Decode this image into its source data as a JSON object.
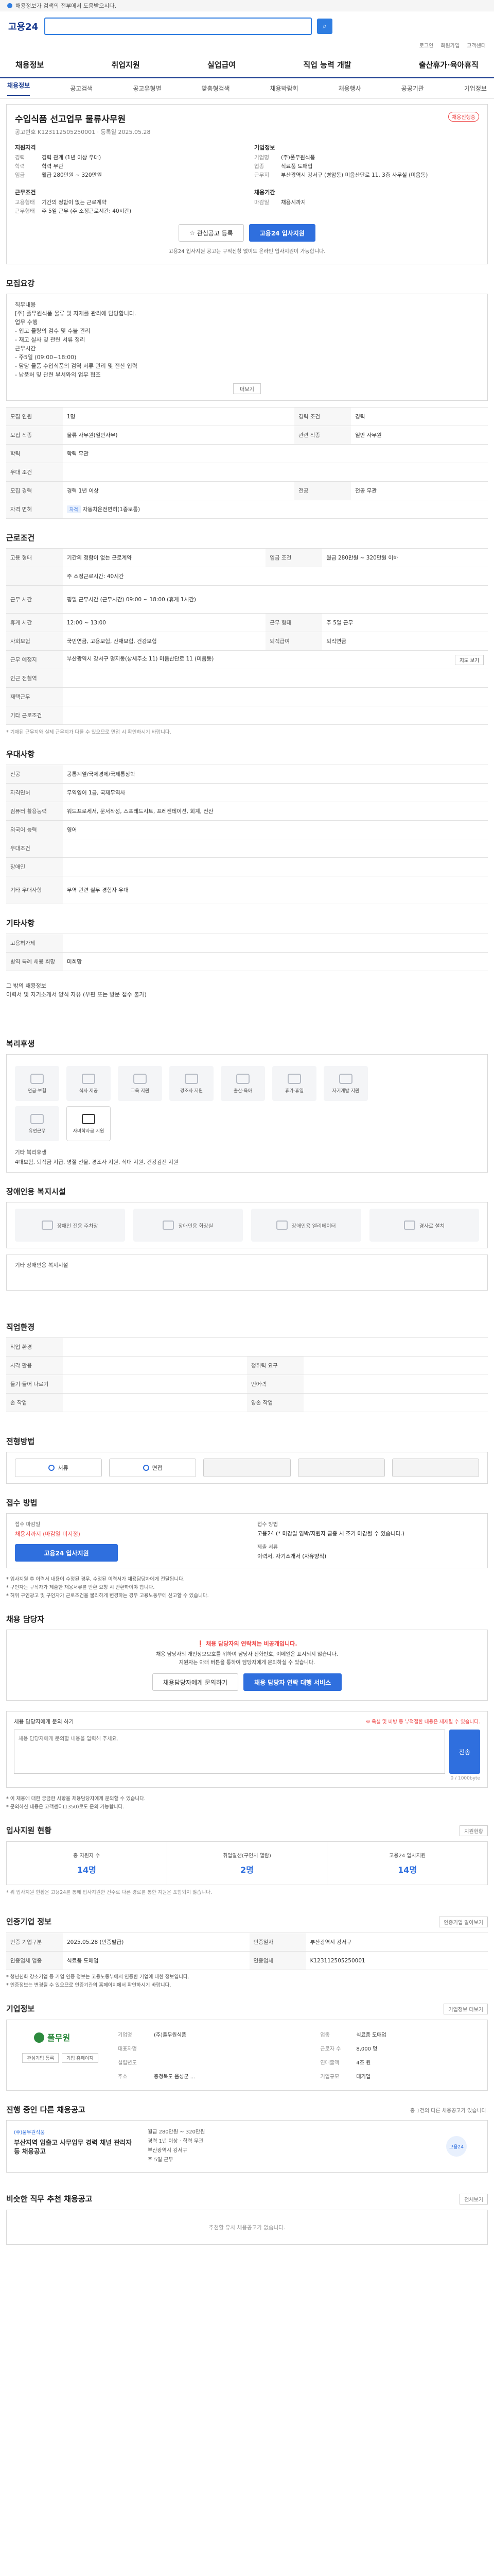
{
  "browser_bar": "채용정보가 검색의 전부에서 도움받으시다.",
  "logo": "고용24",
  "search_placeholder": "",
  "util": [
    "로그인",
    "회원가입",
    "고객센터"
  ],
  "gnb": [
    "채용정보",
    "취업지원",
    "실업급여",
    "직업 능력 개발",
    "출산휴가·육아휴직"
  ],
  "lnb": [
    "채용정보",
    "공고검색",
    "공고유형별",
    "맞춤형검색",
    "채용박람회",
    "채용행사",
    "공공기관",
    "기업정보"
  ],
  "job": {
    "title": "수입식품 선고업무 물류사무원",
    "tag": "채용진행중",
    "meta": "공고번호 K123112505250001  ·  등록일 2025.05.28",
    "cond_title": "지원자격",
    "company_title": "기업정보",
    "cond": [
      {
        "k": "경력",
        "v": "경력 관계 (1년 이상 우대)"
      },
      {
        "k": "학력",
        "v": "학력 무관"
      },
      {
        "k": "임금",
        "v": "월급 280만원 ~ 320만원"
      }
    ],
    "work_title": "근무조건",
    "work": [
      {
        "k": "고용형태",
        "v": "기간의 정함이 없는 근로계약"
      },
      {
        "k": "근무형태",
        "v": "주 5일 근무 (주 소정근로시간: 40시간)"
      }
    ],
    "company": [
      {
        "k": "기업명",
        "v": "(주)풀무원식품"
      },
      {
        "k": "업종",
        "v": "식료품 도매업"
      },
      {
        "k": "근무지",
        "v": "부산광역시 강서구 (병암동) 미음산단로 11, 3층 사무실 (미음동)"
      }
    ],
    "recruit_title": "채용기간",
    "recruit": [
      {
        "k": "마감일",
        "v": "채용시까지"
      }
    ],
    "btn_like": "관심공고 등록",
    "btn_apply": "고용24 입사지원",
    "notice": "고용24 입사지원 공고는 구직신청 없이도 온라인 입사지원이 가능합니다."
  },
  "sec_duty": "모집요강",
  "duty_text": "직무내용\n[주] 풀무원식품 물류 및 자재를 관리에 담당합니다.\n업무 수행\n- 입고 물량의 검수 및 수불 관리\n- 재고 실사 및 관련 서류 정리\n근무시간\n- 주5일 (09:00~18:00)\n- 담당 물품 수입식품의 검역 서류 관리 및 전산 입력\n- 납품처 및 관련 부서와의 업무 협조",
  "duty_more": "더보기",
  "duty_table": [
    {
      "h": "모집 인원",
      "v": "1명",
      "h2": "경력 조건",
      "v2": "경력"
    },
    {
      "h": "모집 직종",
      "v": "물류 사무원(일반사무)",
      "h2": "관련 직종",
      "v2": "일반 사무원"
    },
    {
      "h": "학력",
      "v": "학력 무관",
      "h2": "",
      "v2": ""
    },
    {
      "h": "우대 조건",
      "v": "",
      "h2": "",
      "v2": ""
    },
    {
      "h": "모집 경력",
      "v": "경력 1년 이상",
      "h2": "전공",
      "v2": "전공 무관"
    },
    {
      "h": "자격 면허",
      "v": "자동차운전면허(1종보통)",
      "h2": "",
      "v2": ""
    }
  ],
  "sec_work": "근로조건",
  "work_table": [
    {
      "h": "고용 형태",
      "v": "기간의 정함이 없는 근로계약",
      "h2": "임금 조건",
      "v2": "월급 280만원 ~ 320만원 이하"
    },
    {
      "h": "",
      "v": "주 소정근로시간: 40시간",
      "h2": "",
      "v2": ""
    },
    {
      "h": "근무 시간",
      "v": "평일 근무시간 (근무시간) 09:00 ~ 18:00 (휴게 1시간)",
      "h2": "",
      "v2": ""
    },
    {
      "h": "휴게 시간",
      "v": "12:00 ~ 13:00",
      "h2": "근무 형태",
      "v2": "주 5일 근무"
    },
    {
      "h": "사회보험",
      "v": "국민연금, 고용보험, 산재보험, 건강보험",
      "h2": "퇴직급여",
      "v2": "퇴직연금"
    },
    {
      "h": "근무 예정지",
      "v": "부산광역시 강서구 명지동(상세주소 11) 미음산단로 11 (미음동)",
      "h2": "",
      "v2": ""
    },
    {
      "h": "인근 전철역",
      "v": "",
      "h2": "",
      "v2": ""
    },
    {
      "h": "재택근무",
      "v": "",
      "h2": "",
      "v2": ""
    },
    {
      "h": "기타 근로조건",
      "v": "",
      "h2": "",
      "v2": ""
    }
  ],
  "work_note": "* 기재된 근무지와 실제 근무지가 다를 수 있으므로 면접 시 확인하시기 바랍니다.",
  "map_button": "지도 보기",
  "sec_apply": "우대사항",
  "apply_table": [
    {
      "h": "전공",
      "v": "공통계열/국제경제/국제통상학"
    },
    {
      "h": "자격면허",
      "v": "무역영어 1급, 국제무역사"
    },
    {
      "h": "컴퓨터 활용능력",
      "v": "워드프로세서, 문서작성, 스프레드시트, 프레젠테이션, 회계, 전산"
    },
    {
      "h": "외국어 능력",
      "v": "영어"
    },
    {
      "h": "우대조건",
      "v": ""
    },
    {
      "h": "장애인",
      "v": ""
    },
    {
      "h": "기타 우대사항",
      "v": "무역 관련 실무 경험자 우대"
    }
  ],
  "sec_etc": "기타사항",
  "etc_table": [
    {
      "h": "고용허가제",
      "v": ""
    },
    {
      "h": "병역 특례 채용 희망",
      "v": "미희망"
    }
  ],
  "etc_text": "그 밖의 채용정보\n이력서 및 자기소개서 양식 자유 (우편 또는 방문 접수 불가)",
  "sec_welfare": "복리후생",
  "welfare_icons": [
    "연금·보험",
    "식사 제공",
    "교육 지원",
    "경조사 지원",
    "출산·육아",
    "휴가·휴일",
    "자기개발 지원",
    "유연근무",
    "자녀학자금 지원"
  ],
  "welfare_on": [
    8
  ],
  "welfare_sub_title": "기타 복리후생",
  "welfare_sub": "4대보험, 퇴직금 지급, 명절 선물, 경조사 지원, 식대 지원, 건강검진 지원",
  "sec_facility": "장애인용 복지시설",
  "facility": [
    "장애인 전용 주차장",
    "장애인용 화장실",
    "장애인용 엘리베이터",
    "경사로 설치"
  ],
  "facility_sub": "기타 장애인용 복지시설",
  "sec_job": "직업환경",
  "env_table": [
    {
      "h": "작업 환경",
      "v": "",
      "h2": "",
      "v2": ""
    },
    {
      "h": "시각 활용",
      "v": "",
      "h2": "청취력 요구",
      "v2": ""
    },
    {
      "h": "들기·들어 나르기",
      "v": "",
      "h2": "언어력",
      "v2": ""
    },
    {
      "h": "손 작업",
      "v": "",
      "h2": "양손 작업",
      "v2": ""
    }
  ],
  "sec_process": "전형방법",
  "process": [
    "서류",
    "면접",
    "",
    "",
    ""
  ],
  "sec_how": "접수 방법",
  "how": {
    "label1": "접수 마감일",
    "dday": "채용시까지 (마감일 미지정)",
    "label2": "접수 방법",
    "method": "고용24 (* 마감일 임박/지원자 급증 시 조기 마감될 수 있습니다.)",
    "label3": "제출 서류",
    "docs": "이력서, 자기소개서 (자유양식)",
    "btn": "고용24 입사지원"
  },
  "bullets": "* 입사지원 후 이력서 내용이 수정된 경우, 수정된 이력서가 채용담당자에게 전달됩니다.\n* 구인자는 구직자가 제출한 채용서류를 반환 요청 시 반환하여야 합니다.\n* 허위 구인광고 및 구인자가 근로조건을 불리하게 변경하는 경우 고용노동부에 신고할 수 있습니다.",
  "sec_manager": "채용 담당자",
  "manager": {
    "warn": "채용 담당자의 연락처는 비공개입니다.",
    "desc": "채용 담당자의 개인정보보호를 위하여 담당자 전화번호, 이메일은 표시되지 않습니다.\n지원자는 아래 버튼을 통하여 담당자에게 문의하실 수 있습니다.",
    "btn1": "채용담당자에게 문의하기",
    "btn2": "채용 담당자 연락 대행 서비스"
  },
  "qa": {
    "title": "채용 담당자에게 문의 하기",
    "right": "※ 욕설 및 비방 등 부적절한 내용은 제재될 수 있습니다.",
    "placeholder": "채용 담당자에게 문의할 내용을 입력해 주세요.",
    "send": "전송",
    "count": "0 / 1000byte",
    "note": "* 이 채용에 대한 궁금한 사항을 채용담당자에게 문의할 수 있습니다.\n* 문의하신 내용은 고객센터(1350)로도 문의 가능합니다."
  },
  "sec_stats": "입사지원 현황",
  "stats_link": "지원현황",
  "stats": [
    {
      "label": "총 지원자 수",
      "value": "14명"
    },
    {
      "label": "취업알선(구인처 열람)",
      "value": "2명"
    },
    {
      "label": "고용24 입사지원",
      "value": "14명"
    }
  ],
  "stats_note": "* 위 입사지원 현황은 고용24를 통해 입사지원한 건수로 다른 경로를 통한 지원은 포함되지 않습니다.",
  "sec_recruit": "인증기업 정보",
  "recruit_link": "인증기업 알아보기",
  "recruit_table": [
    {
      "h": "인증 기업구분",
      "v": "2025.05.28 (인증발급)",
      "h2": "인증일자",
      "v2": "부산광역시 강서구"
    },
    {
      "h": "인증업체 업종",
      "v": "식료품 도매업",
      "h2": "인증업체",
      "v2": "K123112505250001"
    }
  ],
  "recruit_note": "* 청년친화 강소기업 등 기업 인증 정보는 고용노동부에서 인증한 기업에 대한 정보입니다.\n* 인증정보는 변경될 수 있으므로 인증기관의 홈페이지에서 확인하시기 바랍니다.",
  "sec_company": "기업정보",
  "company_link": "기업정보 더보기",
  "company": {
    "name": "풀무원",
    "btn1": "관심기업 등록",
    "btn2": "기업 홈페이지",
    "rows": [
      {
        "h": "기업명",
        "v": "(주)풀무원식품",
        "h2": "업종",
        "v2": "식료품 도매업"
      },
      {
        "h": "대표자명",
        "v": "",
        "h2": "근로자 수",
        "v2": "8,000 명"
      },
      {
        "h": "설립년도",
        "v": "",
        "h2": "연매출액",
        "v2": "4조 원"
      },
      {
        "h": "주소",
        "v": "충청북도 음성군 ...",
        "h2": "기업규모",
        "v2": "대기업"
      }
    ]
  },
  "sec_related": "진행 중인 다른 채용공고",
  "related_note": "총 1건의 다른 채용공고가 있습니다.",
  "related": {
    "company": "(주)풀무원식품",
    "title": "부산지역 입출고 사무업무 경력 채널 관리자 등 채용공고",
    "info": "월급 280만원 ~ 320만원\n경력 1년 이상  ·  학력 무관\n부산광역시 강서구\n주 5일 근무",
    "badge": "고용24"
  },
  "sec_similar": "비슷한 직무 추천 채용공고",
  "similar_link": "전체보기",
  "similar_empty": "추천할 유사 채용공고가 없습니다."
}
